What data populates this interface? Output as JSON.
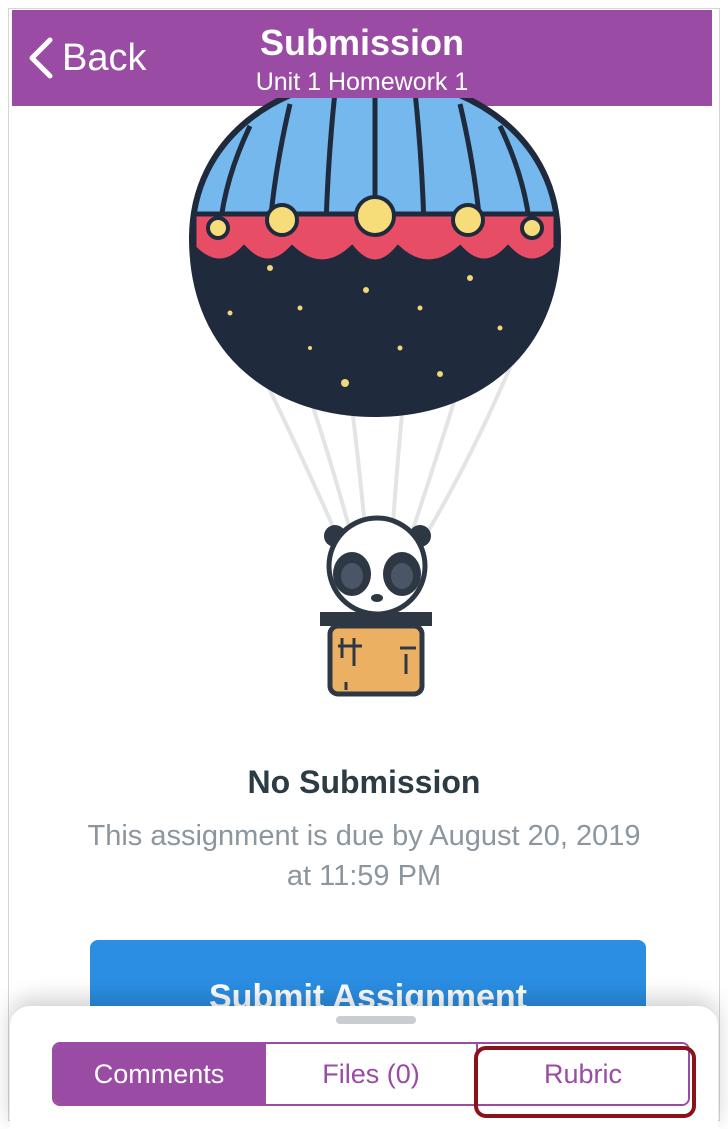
{
  "navbar": {
    "back_label": "Back",
    "title": "Submission",
    "subtitle": "Unit 1 Homework 1",
    "color": "#9a4ba4"
  },
  "illustration": {
    "name": "panda-hot-air-balloon"
  },
  "status": {
    "title": "No Submission",
    "due_line1": "This assignment is due by August 20, 2019",
    "due_line2": "at 11:59 PM"
  },
  "submit_button": {
    "label": "Submit Assignment",
    "color": "#2b8ee3"
  },
  "drawer": {
    "tabs": [
      {
        "label": "Comments",
        "active": true
      },
      {
        "label": "Files (0)",
        "active": false
      },
      {
        "label": "Rubric",
        "active": false,
        "highlighted": true
      }
    ],
    "highlight_color": "#8b1219"
  }
}
